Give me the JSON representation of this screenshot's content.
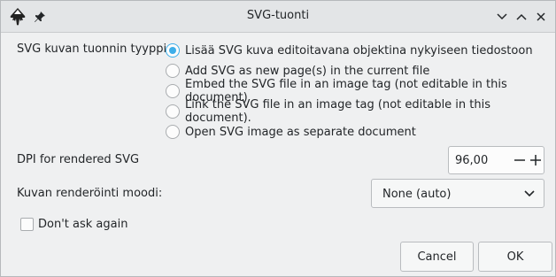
{
  "window": {
    "title": "SVG-tuonti"
  },
  "import_type": {
    "label": "SVG kuvan tuonnin tyyppi:",
    "options": [
      {
        "label": "Lisää SVG kuva editoitavana objektina nykyiseen tiedostoon",
        "selected": true
      },
      {
        "label": "Add SVG as new page(s) in the current file",
        "selected": false
      },
      {
        "label": "Embed the SVG file in an image tag (not editable in this document)",
        "selected": false
      },
      {
        "label": "Link the SVG file in an image tag (not editable in this document).",
        "selected": false
      },
      {
        "label": "Open SVG image as separate document",
        "selected": false
      }
    ]
  },
  "dpi": {
    "label": "DPI for rendered SVG",
    "value": "96,00"
  },
  "render_mode": {
    "label": "Kuvan renderöinti moodi:",
    "value": "None (auto)"
  },
  "dont_ask": {
    "label": "Don't ask again",
    "checked": false
  },
  "buttons": {
    "cancel": "Cancel",
    "ok": "OK"
  },
  "colors": {
    "accent": "#3daee9",
    "window_bg": "#eff0f1",
    "titlebar_bg": "#e3e5e7"
  }
}
